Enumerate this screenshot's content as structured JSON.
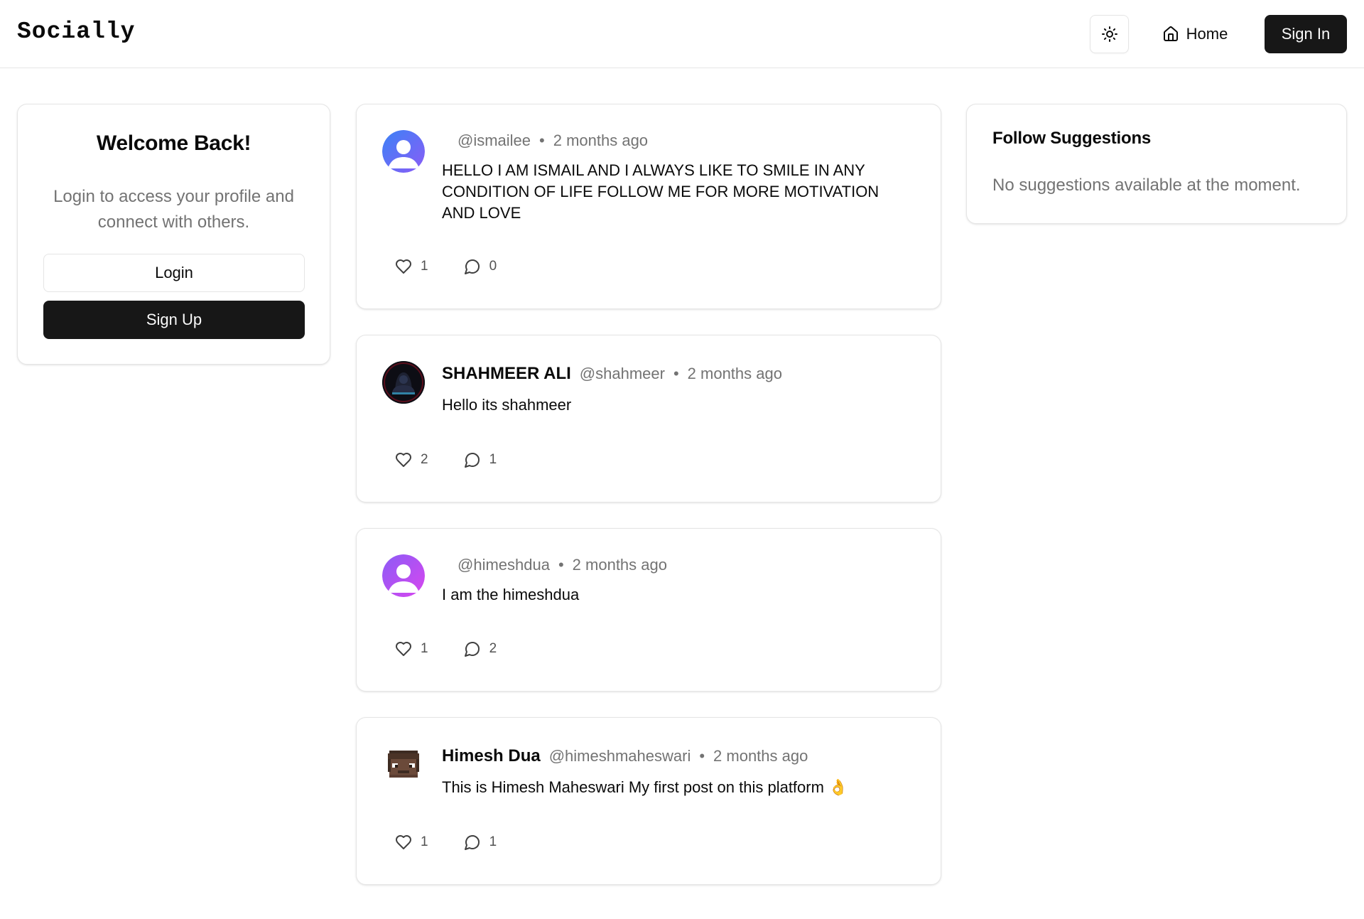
{
  "header": {
    "logo": "Socially",
    "home_label": "Home",
    "signin_label": "Sign In"
  },
  "welcome": {
    "title": "Welcome Back!",
    "subtitle": "Login to access your profile and connect with others.",
    "login_label": "Login",
    "signup_label": "Sign Up"
  },
  "suggestions": {
    "title": "Follow Suggestions",
    "empty": "No suggestions available at the moment."
  },
  "posts": [
    {
      "author": "",
      "handle": "@ismailee",
      "time": "2 months ago",
      "content": "HELLO I AM ISMAIL AND I ALWAYS LIKE TO SMILE IN ANY CONDITION OF LIFE FOLLOW ME FOR MORE MOTIVATION AND LOVE",
      "likes": "1",
      "comments": "0"
    },
    {
      "author": "SHAHMEER ALI",
      "handle": "@shahmeer",
      "time": "2 months ago",
      "content": "Hello its shahmeer",
      "likes": "2",
      "comments": "1"
    },
    {
      "author": "",
      "handle": "@himeshdua",
      "time": "2 months ago",
      "content": "I am the himeshdua",
      "likes": "1",
      "comments": "2"
    },
    {
      "author": "Himesh Dua",
      "handle": "@himeshmaheswari",
      "time": "2 months ago",
      "content": "This is Himesh Maheswari My first post on this platform 👌",
      "likes": "1",
      "comments": "1"
    }
  ],
  "colors": {
    "primary": "#171717",
    "muted_text": "#737373",
    "border": "#e5e5e5",
    "avatar_gradient_1": [
      "#3b82f6",
      "#8b5cf6"
    ],
    "avatar_gradient_3": [
      "#8b5cf6",
      "#d946ef"
    ]
  },
  "icons": {
    "theme": "sun-icon",
    "home": "home-icon",
    "like": "heart-icon",
    "comment": "comment-icon"
  }
}
